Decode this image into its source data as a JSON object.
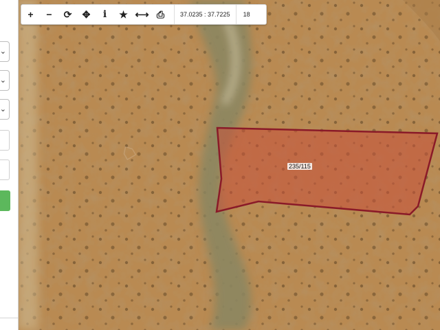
{
  "toolbar": {
    "icons": [
      "zoom-in-icon",
      "zoom-out-icon",
      "refresh-icon",
      "locate-icon",
      "info-icon",
      "favorite-icon",
      "measure-icon",
      "print-icon"
    ],
    "glyphs": [
      "+",
      "−",
      "⟳",
      "✥",
      "i",
      "★",
      "⟷",
      "⎙"
    ],
    "coordinates": "37.0235 : 37.7225",
    "zoom_level": "18"
  },
  "parcel": {
    "label": "235/115",
    "fill_color": "#c9503a",
    "border_color": "#8a1a28"
  },
  "sidebar": {
    "button_color": "#5cb85c"
  },
  "map": {
    "terrain_color": "#b98a52",
    "valley_color": "#8c8660"
  }
}
